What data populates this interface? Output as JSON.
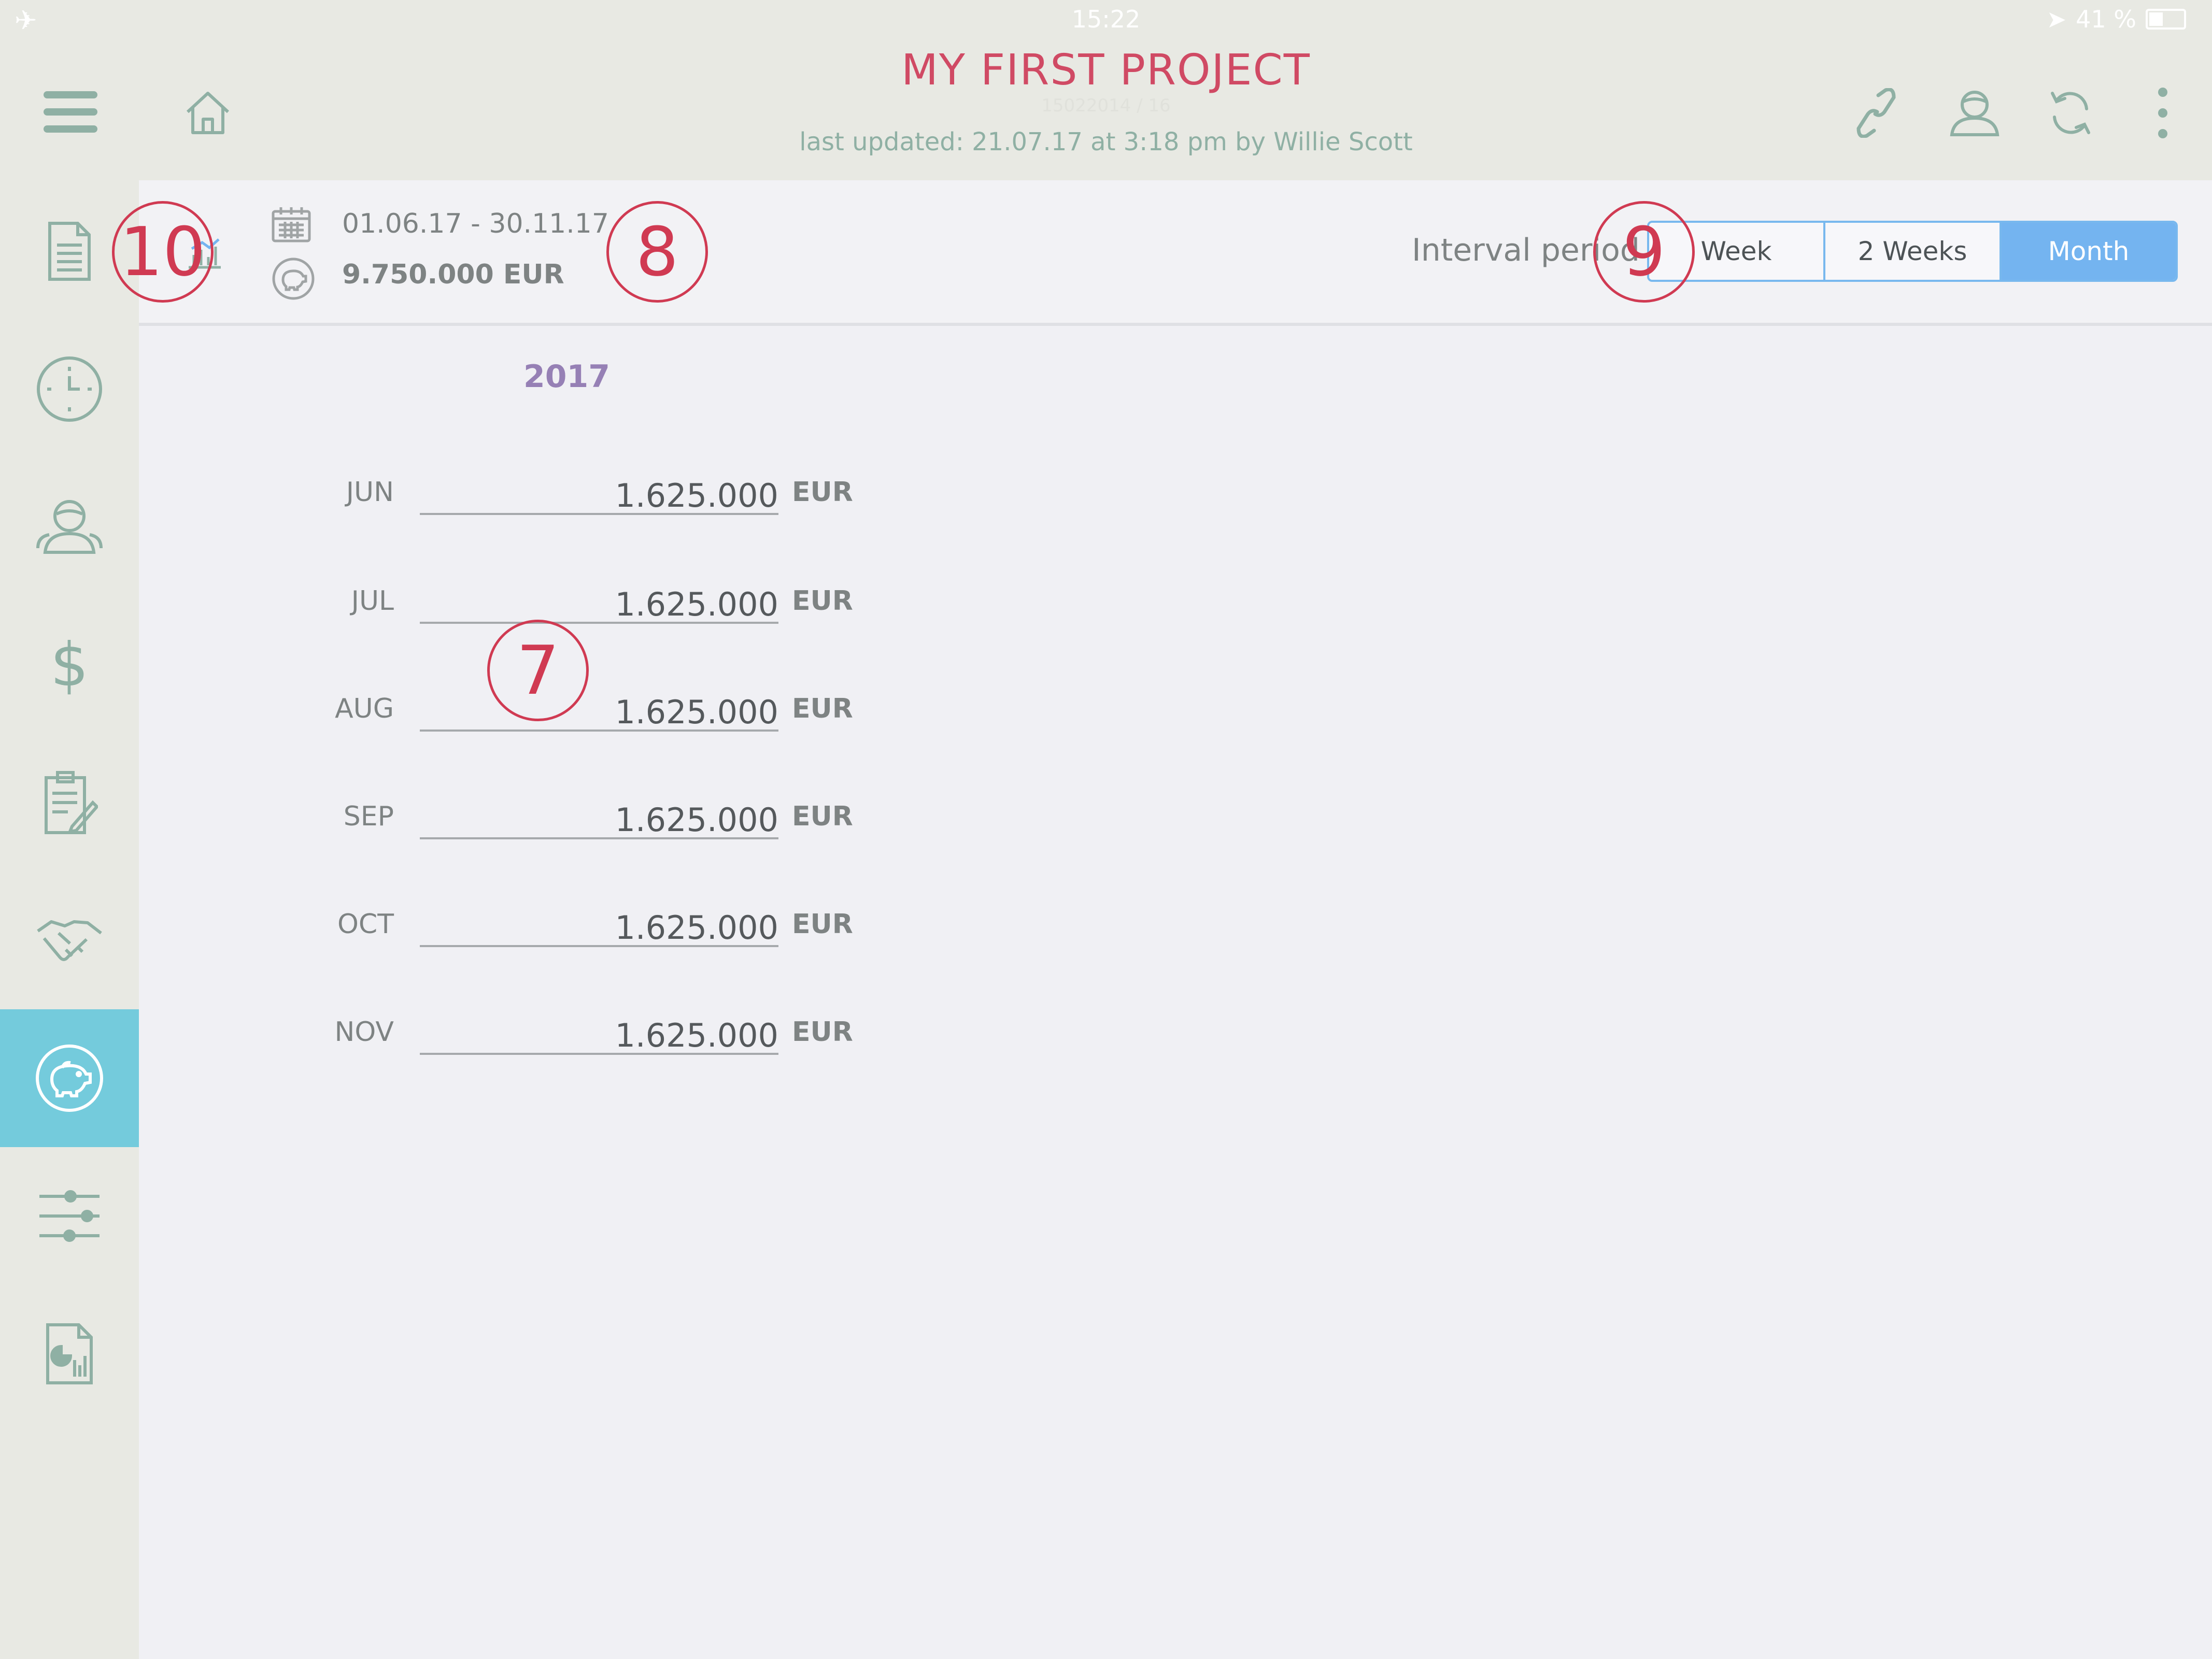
{
  "status_bar": {
    "time": "15:22",
    "battery": "41 %"
  },
  "header": {
    "title": "MY FIRST PROJECT",
    "subtitle": "15022014 / 16",
    "last_updated": "last updated: 21.07.17 at 3:18 pm by Willie Scott"
  },
  "top_icons": [
    "menu-icon",
    "home-icon",
    "link-icon",
    "person-icon",
    "sync-icon",
    "more-icon"
  ],
  "sidebar": {
    "items": [
      {
        "icon": "document-icon"
      },
      {
        "icon": "clock-icon"
      },
      {
        "icon": "team-icon"
      },
      {
        "icon": "dollar-icon"
      },
      {
        "icon": "clipboard-edit-icon"
      },
      {
        "icon": "handshake-icon"
      },
      {
        "icon": "piggy-bank-icon",
        "active": true
      },
      {
        "icon": "sliders-icon"
      },
      {
        "icon": "report-icon"
      }
    ]
  },
  "info": {
    "date_range": "01.06.17 - 30.11.17",
    "budget_total": "9.750.000 EUR"
  },
  "interval": {
    "label": "Interval period",
    "options": [
      "Week",
      "2 Weeks",
      "Month"
    ],
    "selected": "Month"
  },
  "budget": {
    "year": "2017",
    "rows": [
      {
        "month": "JUN",
        "value": "1.625.000",
        "unit": "EUR"
      },
      {
        "month": "JUL",
        "value": "1.625.000",
        "unit": "EUR"
      },
      {
        "month": "AUG",
        "value": "1.625.000",
        "unit": "EUR"
      },
      {
        "month": "SEP",
        "value": "1.625.000",
        "unit": "EUR"
      },
      {
        "month": "OCT",
        "value": "1.625.000",
        "unit": "EUR"
      },
      {
        "month": "NOV",
        "value": "1.625.000",
        "unit": "EUR"
      }
    ]
  },
  "callouts": [
    "10",
    "8",
    "9",
    "7"
  ],
  "colors": {
    "title": "#d04a64",
    "accent_teal": "#74cbdc",
    "segment_blue": "#74b4f0",
    "callout_red": "#d03a52",
    "year_purple": "#9680b5",
    "icon_green": "#8fb0a4"
  }
}
